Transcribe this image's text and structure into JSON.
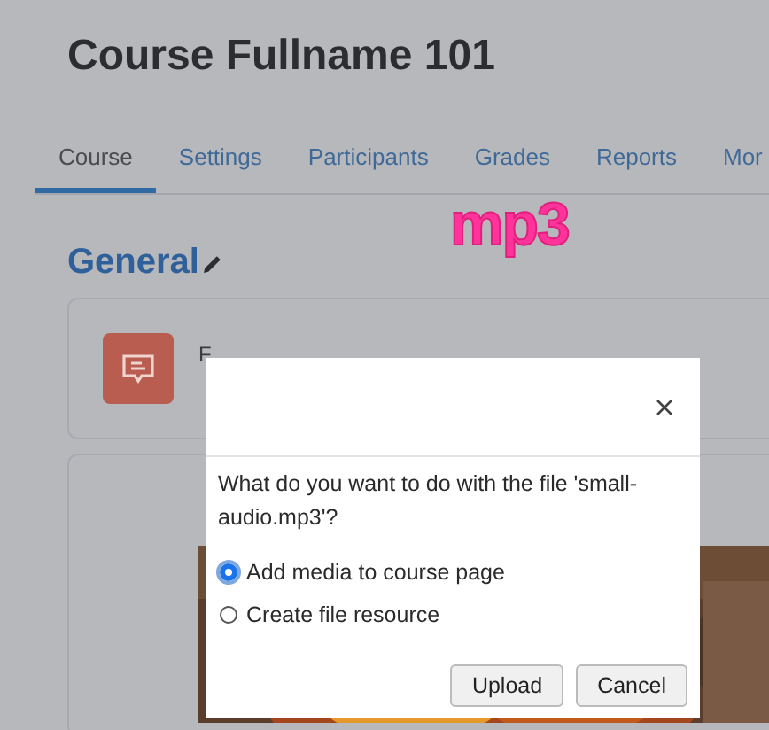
{
  "course_title": "Course Fullname 101",
  "tabs": [
    {
      "label": "Course",
      "selected": true
    },
    {
      "label": "Settings",
      "selected": false
    },
    {
      "label": "Participants",
      "selected": false
    },
    {
      "label": "Grades",
      "selected": false
    },
    {
      "label": "Reports",
      "selected": false
    },
    {
      "label": "Mor",
      "selected": false
    }
  ],
  "section_title": "General",
  "drag_label": "mp3",
  "activity": {
    "line_1": "F"
  },
  "dialog": {
    "question": "What do you want to do with the file 'small-audio.mp3'?",
    "options": [
      {
        "label": "Add media to course page",
        "selected": true
      },
      {
        "label": "Create file resource",
        "selected": false
      }
    ],
    "buttons": [
      "Upload",
      "Cancel"
    ]
  }
}
